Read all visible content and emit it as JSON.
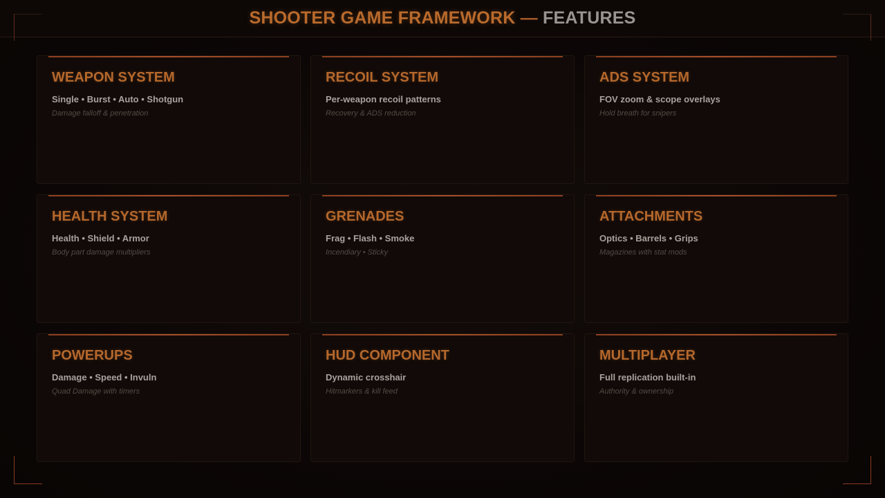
{
  "header": {
    "title_main": "SHOOTER GAME FRAMEWORK",
    "title_sep": "—",
    "title_sub": "FEATURES"
  },
  "colors": {
    "accent": "#b5682c",
    "background": "#0a0605",
    "card_background": "#110a08",
    "text_primary": "#a8a29e",
    "text_muted": "#544a45"
  },
  "features": [
    {
      "title": "WEAPON SYSTEM",
      "line1": "Single • Burst • Auto • Shotgun",
      "line2": "Damage falloff & penetration"
    },
    {
      "title": "RECOIL SYSTEM",
      "line1": "Per-weapon recoil patterns",
      "line2": "Recovery & ADS reduction"
    },
    {
      "title": "ADS SYSTEM",
      "line1": "FOV zoom & scope overlays",
      "line2": "Hold breath for snipers"
    },
    {
      "title": "HEALTH SYSTEM",
      "line1": "Health • Shield • Armor",
      "line2": "Body part damage multipliers"
    },
    {
      "title": "GRENADES",
      "line1": "Frag • Flash • Smoke",
      "line2": "Incendiary • Sticky"
    },
    {
      "title": "ATTACHMENTS",
      "line1": "Optics • Barrels • Grips",
      "line2": "Magazines with stat mods"
    },
    {
      "title": "POWERUPS",
      "line1": "Damage • Speed • Invuln",
      "line2": "Quad Damage with timers"
    },
    {
      "title": "HUD COMPONENT",
      "line1": "Dynamic crosshair",
      "line2": "Hitmarkers & kill feed"
    },
    {
      "title": "MULTIPLAYER",
      "line1": "Full replication built-in",
      "line2": "Authority & ownership"
    }
  ]
}
